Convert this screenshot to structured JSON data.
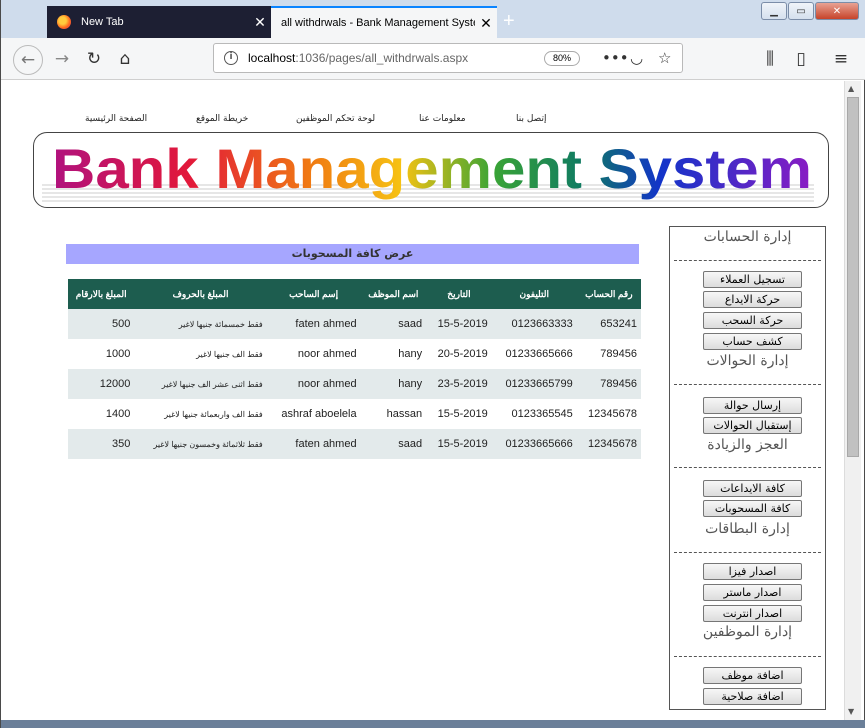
{
  "browser": {
    "tabs": [
      {
        "label": "New Tab",
        "active": false
      },
      {
        "label": "all withdrwals - Bank Management System",
        "active": true
      }
    ],
    "url_host": "localhost",
    "url_path": ":1036/pages/all_withdrwals.aspx",
    "zoom": "80%",
    "accent_color": "#0a84ff"
  },
  "topnav": {
    "home": "الصفحة الرئيسية",
    "sitemap": "خريطة الموقع",
    "staff_panel": "لوحة تحكم الموظفين",
    "about": "معلومات عنا",
    "contact": "إتصل بنا"
  },
  "banner": {
    "title": "Bank Management System"
  },
  "content": {
    "title": "عرض كافة المسحوبات",
    "columns": [
      "رقم الحساب",
      "التليفون",
      "التاريخ",
      "اسم الموظف",
      "إسم الساحب",
      "المبلغ بالحروف",
      "المبلغ بالارقام"
    ],
    "rows": [
      [
        "653241",
        "0123663333",
        "15-5-2019",
        "saad",
        "faten ahmed",
        "فقط خمسمائة جنيها لاغير",
        "500"
      ],
      [
        "789456",
        "01233665666",
        "20-5-2019",
        "hany",
        "noor ahmed",
        "فقط الف جنيها لاغير",
        "1000"
      ],
      [
        "789456",
        "01233665799",
        "23-5-2019",
        "hany",
        "noor ahmed",
        "فقط اثنى عشر الف جنيها لاغير",
        "12000"
      ],
      [
        "12345678",
        "0123365545",
        "15-5-2019",
        "hassan",
        "ashraf aboelela",
        "فقط الف واربعمائة جنيها لاغير",
        "1400"
      ],
      [
        "12345678",
        "01233665666",
        "15-5-2019",
        "saad",
        "faten ahmed",
        "فقط ثلاثمائة وخمسون جنيها لاغير",
        "350"
      ]
    ],
    "header_color": "#1d5d4f",
    "title_bar_color": "#a6a6ff"
  },
  "sidebar": {
    "separator": "-------------------------------",
    "sections": [
      {
        "heading": "إدارة الحسابات",
        "buttons": [
          "تسجيل العملاء",
          "حركة الايداع",
          "حركة السحب",
          "كشف حساب"
        ]
      },
      {
        "heading": "إدارة الحوالات",
        "buttons": [
          "إرسال حوالة",
          "إستقبال الحوالات"
        ]
      },
      {
        "heading": "العجز والزيادة",
        "buttons": [
          "كافة الايداعات",
          "كافة المسحوبات"
        ]
      },
      {
        "heading": "إدارة البطاقات",
        "buttons": [
          "اصدار فيزا",
          "اصدار ماستر",
          "اصدار انترنت"
        ]
      },
      {
        "heading": "إدارة الموظفين",
        "buttons": [
          "اضافة موظف",
          "اضافة صلاحية"
        ]
      }
    ]
  }
}
